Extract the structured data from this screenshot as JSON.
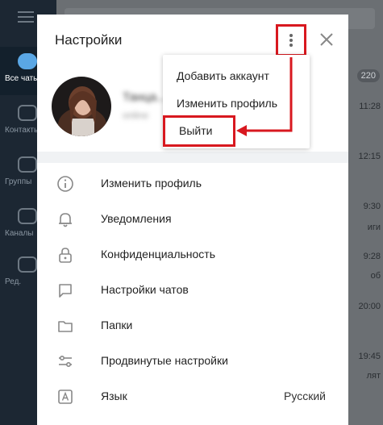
{
  "sidebar": {
    "items": [
      {
        "label": "Все чаты",
        "icon": "chat-bubble-icon"
      },
      {
        "label": "Контакты",
        "icon": "folder-icon"
      },
      {
        "label": "Группы",
        "icon": "group-icon"
      },
      {
        "label": "Каналы",
        "icon": "channel-icon"
      },
      {
        "label": "Ред.",
        "icon": "sliders-icon"
      }
    ]
  },
  "chat_list": {
    "badge": "220",
    "times": [
      "11:28",
      "12:15",
      "9:30",
      "9:28",
      "20:00",
      "19:45"
    ],
    "snippets": [
      "иги",
      "об",
      "лят"
    ]
  },
  "dialog": {
    "title": "Настройки",
    "profile": {
      "name": "Танца...",
      "status": "online"
    },
    "menu": {
      "items": [
        "Добавить аккаунт",
        "Изменить профиль",
        "Выйти"
      ]
    },
    "settings": [
      {
        "label": "Изменить профиль",
        "icon": "info-icon",
        "value": ""
      },
      {
        "label": "Уведомления",
        "icon": "bell-icon",
        "value": ""
      },
      {
        "label": "Конфиденциальность",
        "icon": "lock-icon",
        "value": ""
      },
      {
        "label": "Настройки чатов",
        "icon": "chat-square-icon",
        "value": ""
      },
      {
        "label": "Папки",
        "icon": "folder-icon",
        "value": ""
      },
      {
        "label": "Продвинутые настройки",
        "icon": "sliders-icon",
        "value": ""
      },
      {
        "label": "Язык",
        "icon": "language-icon",
        "value": "Русский"
      }
    ]
  },
  "colors": {
    "highlight_red": "#d8181f",
    "accent_blue": "#5aa7e5"
  }
}
